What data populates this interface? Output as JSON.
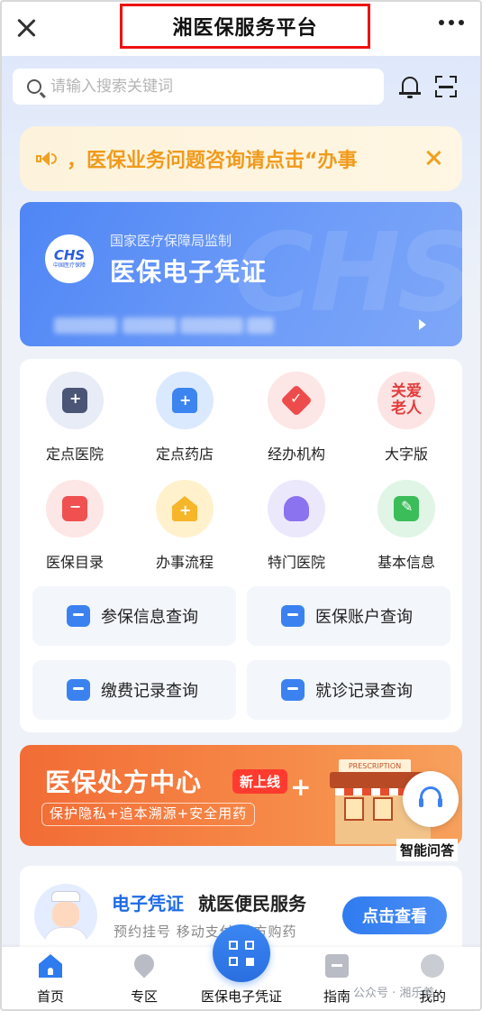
{
  "header": {
    "title": "湘医保服务平台"
  },
  "search": {
    "placeholder": "请输入搜索关键词"
  },
  "notice": {
    "text": "，医保业务问题咨询请点击“办事"
  },
  "card": {
    "subtitle": "国家医疗保障局监制",
    "title": "医保电子凭证",
    "logo_main": "CHS",
    "logo_sub": "中国医疗保障",
    "watermark": "CHS"
  },
  "services": [
    {
      "label": "定点医院",
      "icon": "hospital-icon"
    },
    {
      "label": "定点药店",
      "icon": "pharmacy-icon"
    },
    {
      "label": "经办机构",
      "icon": "agency-icon"
    },
    {
      "label": "大字版",
      "icon": "elderly-care-icon",
      "icon_text": "关爱老人"
    },
    {
      "label": "医保目录",
      "icon": "catalog-icon"
    },
    {
      "label": "办事流程",
      "icon": "process-icon"
    },
    {
      "label": "特门医院",
      "icon": "special-clinic-icon"
    },
    {
      "label": "基本信息",
      "icon": "basic-info-icon"
    }
  ],
  "quick_queries": [
    {
      "label": "参保信息查询",
      "icon": "insurance-info-icon"
    },
    {
      "label": "医保账户查询",
      "icon": "account-icon"
    },
    {
      "label": "缴费记录查询",
      "icon": "payment-record-icon"
    },
    {
      "label": "就诊记录查询",
      "icon": "visit-record-icon"
    }
  ],
  "banner": {
    "title": "医保处方中心",
    "badge": "新上线",
    "subtitle": "保护隐私+追本溯源+安全用药",
    "sign_text": "PRESCRIPTION",
    "plus": "+"
  },
  "assistant": {
    "label": "智能问答",
    "icon": "headset-icon"
  },
  "promo": {
    "title_highlight": "电子凭证",
    "title_rest": "就医便民服务",
    "subtitle": "预约挂号  移动支付  处方购药",
    "button": "点击查看"
  },
  "nav": {
    "items": [
      {
        "label": "首页",
        "icon": "home-icon",
        "active": true
      },
      {
        "label": "专区",
        "icon": "location-icon",
        "active": false
      },
      {
        "label": "医保电子凭证",
        "icon": "qr-code-icon",
        "active": false
      },
      {
        "label": "指南",
        "icon": "guide-icon",
        "active": false
      },
      {
        "label": "我的",
        "icon": "profile-icon",
        "active": false
      }
    ]
  },
  "watermark": "公众号 · 湘乐差",
  "colors": {
    "accent": "#2f7bf0",
    "notice": "#f09a1c",
    "banner": "#f26c36",
    "highlight_box": "#e11111"
  }
}
